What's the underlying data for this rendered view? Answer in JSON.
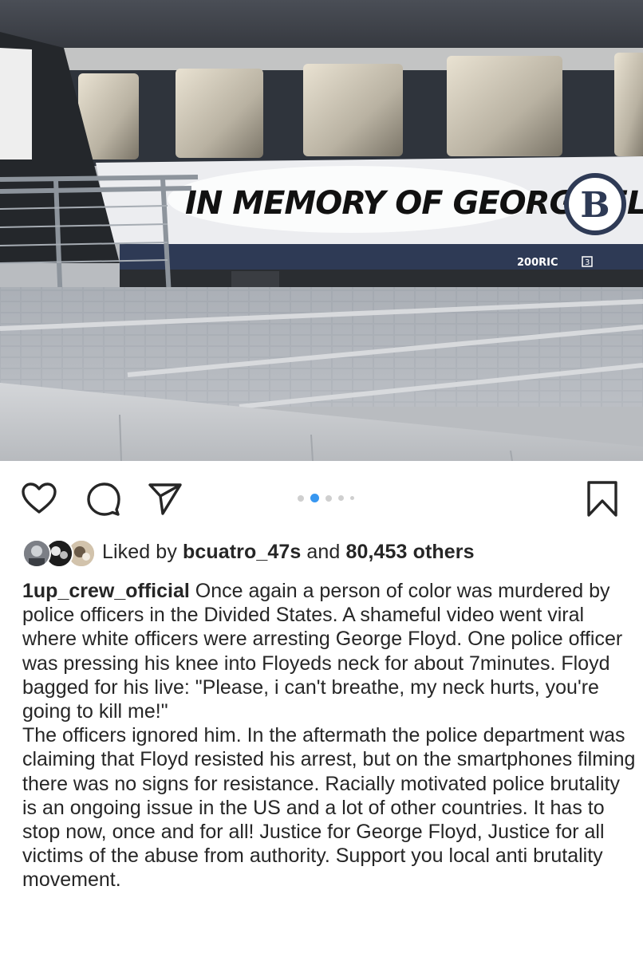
{
  "photo": {
    "graffiti_text": "IN MEMORY OF GEORGE FLOYD..",
    "logo_letter": "B",
    "car_marking": "200RIC",
    "car_number": "3"
  },
  "actions": {
    "like_icon": "heart-icon",
    "comment_icon": "comment-icon",
    "share_icon": "share-icon",
    "save_icon": "bookmark-icon",
    "carousel_total": 5,
    "carousel_active_index": 2
  },
  "likes": {
    "prefix": "Liked by",
    "user": "bcuatro_47s",
    "connector": "and",
    "count": "80,453 others"
  },
  "caption": {
    "username": "1up_crew_official",
    "paragraph1": "Once again a person of color was murdered by police officers in the Divided States. A shameful video went viral where white officers were arresting George Floyd. One police officer was pressing his knee into Floyeds neck for about 7minutes. Floyd bagged for his live: \"Please, i can't breathe, my neck hurts, you're going to kill me!\"",
    "paragraph2": "The officers ignored him. In the aftermath the police department was claiming that Floyd resisted his arrest, but on the smartphones filming there was no signs for resistance. Racially motivated police brutality is an ongoing issue in the US and a lot of other countries. It has to stop now, once and for all! Justice for George Floyd, Justice for all victims of the abuse from authority. Support you local anti brutality movement."
  },
  "colors": {
    "text": "#262626",
    "accent_dot": "#3897f0",
    "inactive_dot": "#cfcfcf",
    "train_navy": "#2e3a55"
  }
}
